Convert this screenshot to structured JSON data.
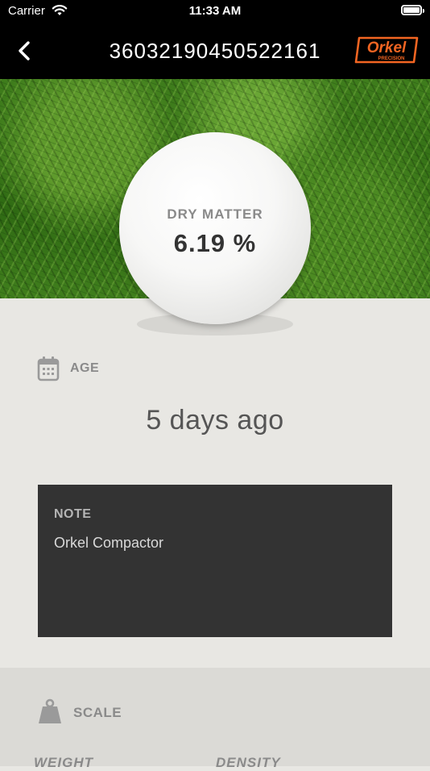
{
  "status_bar": {
    "carrier": "Carrier",
    "time": "11:33 AM"
  },
  "nav": {
    "title": "36032190450522161",
    "logo_text": "Orkel",
    "logo_subtext": "PRECISION",
    "brand_color": "#f26522"
  },
  "measurement": {
    "label": "DRY MATTER",
    "value": "6.19 %"
  },
  "age": {
    "label": "AGE",
    "value": "5 days ago"
  },
  "note": {
    "title": "NOTE",
    "text": "Orkel Compactor"
  },
  "scale": {
    "label": "SCALE",
    "columns": [
      "WEIGHT",
      "DENSITY"
    ]
  },
  "icons": {
    "back": "chevron-left-icon",
    "wifi": "wifi-icon",
    "battery": "battery-icon",
    "calendar": "calendar-icon",
    "scale": "weight-icon"
  }
}
